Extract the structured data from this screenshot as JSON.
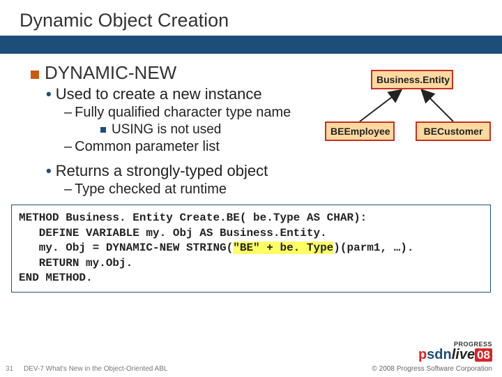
{
  "title": "Dynamic Object Creation",
  "section": {
    "heading": "DYNAMIC-NEW",
    "b1": "Used to create a new instance",
    "b1a": "Fully qualified character type name",
    "b1a1": "USING is not used",
    "b1b": "Common parameter list",
    "b2": "Returns a strongly-typed object",
    "b2a": "Type checked at runtime"
  },
  "diagram": {
    "parent": "Business.Entity",
    "child1": "BEEmployee",
    "child2": "BECustomer"
  },
  "code": {
    "l1": "METHOD Business. Entity Create.BE( be.Type AS CHAR):",
    "l2": "   DEFINE VARIABLE my. Obj AS Business.Entity.",
    "l3a": "   my. Obj = DYNAMIC-NEW STRING(",
    "l3hl": "\"BE\" + be. Type",
    "l3b": ")(parm1, …).",
    "l4": "   RETURN my.Obj.",
    "l5": "END METHOD."
  },
  "footer": {
    "num": "31",
    "session": "DEV-7 What's New in the Object-Oriented ABL",
    "copyright": "© 2008 Progress Software Corporation"
  },
  "logo": {
    "brand": "PROGRESS",
    "p": "p",
    "sdn": "sdn",
    "live": "live",
    "year": "08"
  }
}
